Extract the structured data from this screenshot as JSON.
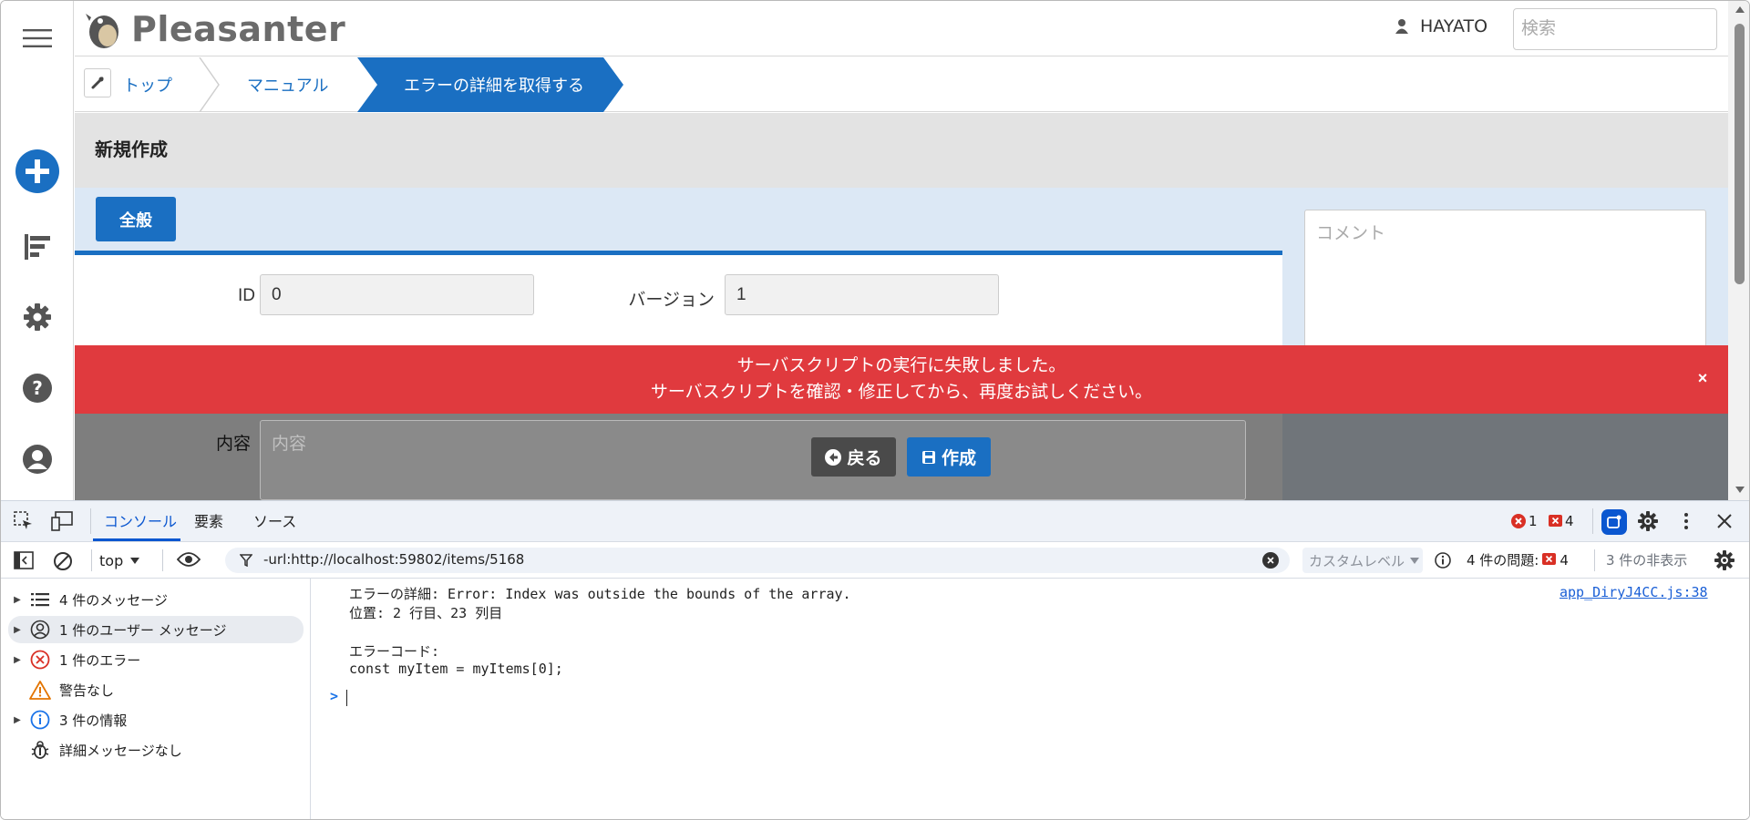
{
  "app": {
    "brand": "Pleasanter",
    "user_name": "HAYATO",
    "search_placeholder": "検索",
    "breadcrumbs": [
      "トップ",
      "マニュアル",
      "エラーの詳細を取得する"
    ],
    "page_title": "新規作成",
    "tab_general": "全般",
    "fields": {
      "id_label": "ID",
      "id_value": "0",
      "version_label": "バージョン",
      "version_value": "1",
      "content_label": "内容",
      "content_placeholder": "内容",
      "comment_placeholder": "コメント"
    },
    "error_banner": {
      "line1": "サーバスクリプトの実行に失敗しました。",
      "line2": "サーバスクリプトを確認・修正してから、再度お試しください。",
      "close": "×"
    },
    "buttons": {
      "back": "戻る",
      "create": "作成"
    },
    "colors": {
      "accent": "#1a6fc2",
      "error": "#e03a3e"
    }
  },
  "devtools": {
    "tabs": [
      "コンソール",
      "要素",
      "ソース"
    ],
    "active_tab": "コンソール",
    "error_count": "1",
    "issue_count": "4",
    "context": "top",
    "filter_text": "-url:http://localhost:59802/items/5168",
    "level_placeholder": "カスタムレベル",
    "issues_label": "4 件の問題:",
    "issues_count": "4",
    "hidden_label": "3 件の非表示",
    "sidebar": [
      {
        "label": "4 件のメッセージ",
        "icon": "list-icon"
      },
      {
        "label": "1 件のユーザー メッセージ",
        "icon": "user-icon"
      },
      {
        "label": "1 件のエラー",
        "icon": "error-icon"
      },
      {
        "label": "警告なし",
        "icon": "warning-icon"
      },
      {
        "label": "3 件の情報",
        "icon": "info-icon"
      },
      {
        "label": "詳細メッセージなし",
        "icon": "bug-icon"
      }
    ],
    "console_lines": [
      "エラーの詳細: Error: Index was outside the bounds of the array.",
      "位置: 2 行目、23 列目",
      "",
      "エラーコード:",
      "const myItem = myItems[0];"
    ],
    "source_link": "app_DiryJ4CC.js:38",
    "prompt": ">"
  }
}
